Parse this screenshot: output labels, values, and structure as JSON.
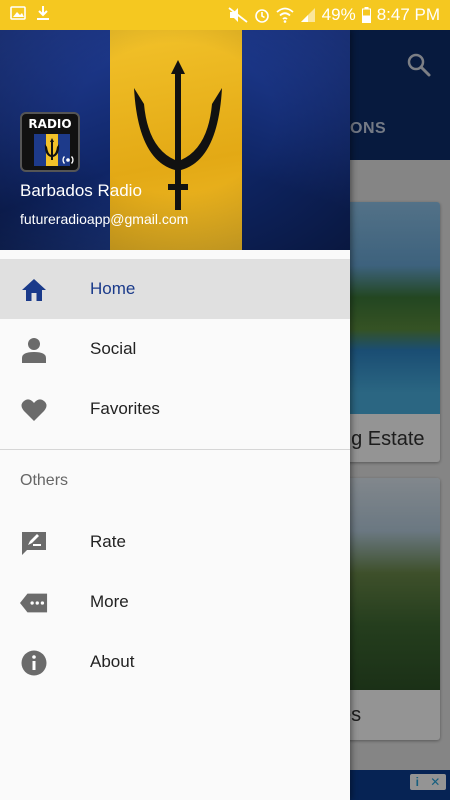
{
  "status_bar": {
    "battery": "49%",
    "time": "8:47 PM"
  },
  "background": {
    "tab_fragment": "ONS",
    "cards": [
      {
        "caption_fragment": "ng Estate"
      },
      {
        "caption_fragment": "es"
      }
    ]
  },
  "drawer": {
    "header": {
      "logo_text": "RADIO",
      "title": "Barbados Radio",
      "email": "futureradioapp@gmail.com"
    },
    "primary_items": [
      {
        "label": "Home",
        "icon": "home-icon",
        "active": true
      },
      {
        "label": "Social",
        "icon": "person-icon",
        "active": false
      },
      {
        "label": "Favorites",
        "icon": "heart-icon",
        "active": false
      }
    ],
    "section_title": "Others",
    "secondary_items": [
      {
        "label": "Rate",
        "icon": "rate-icon"
      },
      {
        "label": "More",
        "icon": "more-icon"
      },
      {
        "label": "About",
        "icon": "info-icon"
      }
    ]
  },
  "colors": {
    "status_bar": "#f5c820",
    "toolbar": "#0d2d6b",
    "active_text": "#1a3a8a",
    "icon_active": "#1a3a8a",
    "icon_default": "#6b6b6b"
  }
}
